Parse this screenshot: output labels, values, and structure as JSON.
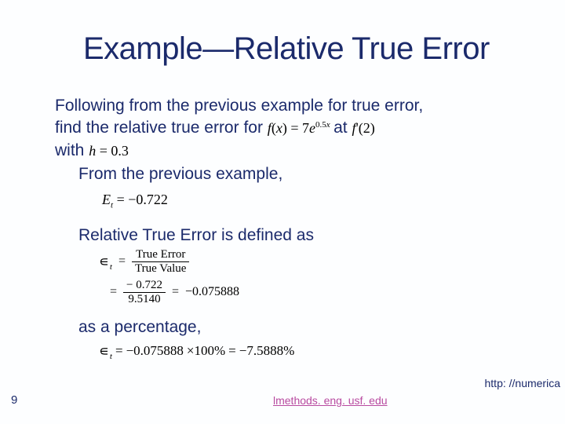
{
  "title": "Example—Relative True Error",
  "body": {
    "para1a": "Following from the previous example for true error,",
    "para1b_prefix": "find the relative true error for ",
    "fx_expr": {
      "lhs": "f",
      "arg": "x",
      "eq": "=",
      "coef": "7",
      "e": "e",
      "exp": "0.5",
      "expvar": "x"
    },
    "at_word": " at ",
    "fprime": {
      "lhs": "f",
      "prime": "'",
      "arg": "2"
    },
    "with_word": "with ",
    "h_expr": {
      "lhs": "h",
      "eq": "=",
      "val": "0.3"
    },
    "from_prev": "From the previous example,",
    "Et": {
      "sym": "E",
      "sub": "t",
      "eq": "=",
      "val": "−0.722"
    },
    "rte_defined": "Relative True Error is defined as",
    "eps_sym": "∊",
    "eps_sub": "t",
    "frac1": {
      "top": "True Error",
      "bot": "True Value"
    },
    "frac2": {
      "top": "− 0.722",
      "bot": "9.5140",
      "result": "−0.075888"
    },
    "as_pct": "as a percentage,",
    "pct_eq": {
      "val": "−0.075888",
      "times": "×100%",
      "eq": "=",
      "result": "−7.5888%"
    }
  },
  "page_number": "9",
  "footer_link": "lmethods. eng. usf. edu",
  "right_url": "http: //numerica"
}
